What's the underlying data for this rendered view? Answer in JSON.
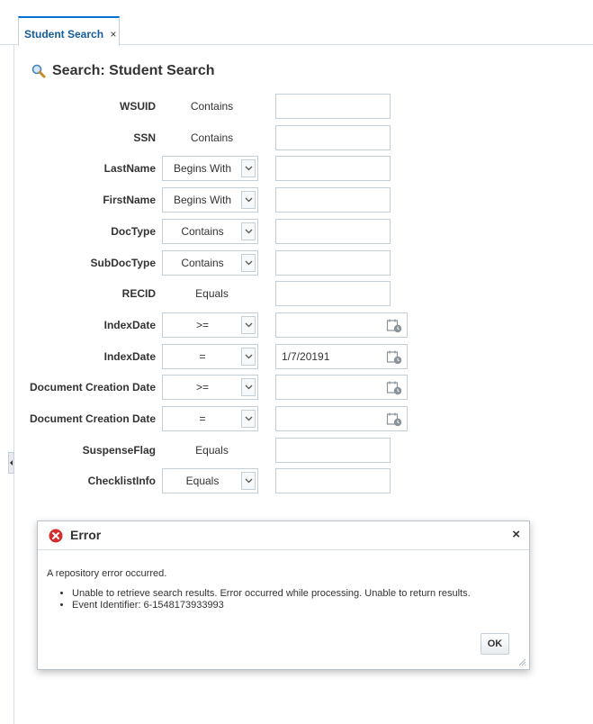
{
  "tabs": [
    {
      "label": "Student Search",
      "close": "×"
    }
  ],
  "search": {
    "title": "Search: Student Search"
  },
  "rows": [
    {
      "label": "WSUID",
      "operator": "Contains",
      "has_dropdown": false,
      "value": "",
      "is_date": false
    },
    {
      "label": "SSN",
      "operator": "Contains",
      "has_dropdown": false,
      "value": "",
      "is_date": false
    },
    {
      "label": "LastName",
      "operator": "Begins With",
      "has_dropdown": true,
      "value": "",
      "is_date": false
    },
    {
      "label": "FirstName",
      "operator": "Begins With",
      "has_dropdown": true,
      "value": "",
      "is_date": false
    },
    {
      "label": "DocType",
      "operator": "Contains",
      "has_dropdown": true,
      "value": "",
      "is_date": false
    },
    {
      "label": "SubDocType",
      "operator": "Contains",
      "has_dropdown": true,
      "value": "",
      "is_date": false
    },
    {
      "label": "RECID",
      "operator": "Equals",
      "has_dropdown": false,
      "value": "",
      "is_date": false
    },
    {
      "label": "IndexDate",
      "operator": ">=",
      "has_dropdown": true,
      "value": "",
      "is_date": true
    },
    {
      "label": "IndexDate",
      "operator": "=",
      "has_dropdown": true,
      "value": "1/7/20191",
      "is_date": true
    },
    {
      "label": "Document Creation Date",
      "operator": ">=",
      "has_dropdown": true,
      "value": "",
      "is_date": true
    },
    {
      "label": "Document Creation Date",
      "operator": "=",
      "has_dropdown": true,
      "value": "",
      "is_date": true
    },
    {
      "label": "SuspenseFlag",
      "operator": "Equals",
      "has_dropdown": false,
      "value": "",
      "is_date": false
    },
    {
      "label": "ChecklistInfo",
      "operator": "Equals",
      "has_dropdown": true,
      "value": "",
      "is_date": false
    }
  ],
  "dialog": {
    "title": "Error",
    "close": "×",
    "message": "A repository error occurred.",
    "details": [
      "Unable to retrieve search results. Error occurred while processing. Unable to return results.",
      "Event Identifier: 6-1548173933993"
    ],
    "ok_label": "OK"
  },
  "colors": {
    "accent": "#0572ce",
    "error": "#d62d2d",
    "border": "#c4ced7"
  }
}
